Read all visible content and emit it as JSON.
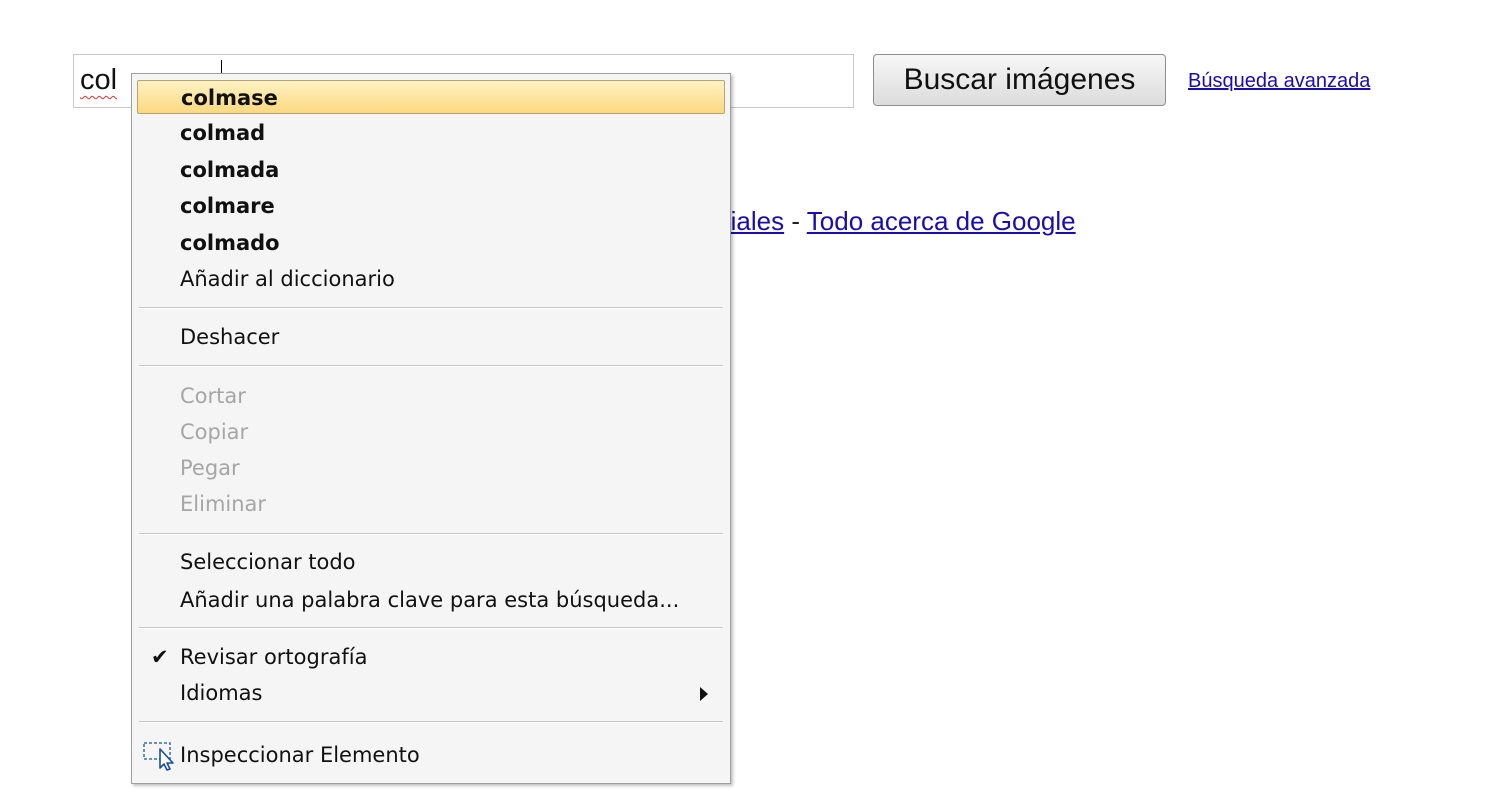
{
  "search": {
    "value": "colmastol",
    "visible_prefix": "col",
    "button_label": "Buscar imágenes",
    "advanced_link": "Búsqueda avanzada"
  },
  "footer": {
    "partial_link": "riales",
    "separator": " - ",
    "about_link": "Todo acerca de Google"
  },
  "context_menu": {
    "suggestions": [
      "colmase",
      "colmad",
      "colmada",
      "colmare",
      "colmado"
    ],
    "add_to_dictionary": "Añadir al diccionario",
    "undo": "Deshacer",
    "cut": "Cortar",
    "copy": "Copiar",
    "paste": "Pegar",
    "delete": "Eliminar",
    "select_all": "Seleccionar todo",
    "add_keyword": "Añadir una palabra clave para esta búsqueda...",
    "check_spelling": "Revisar ortografía",
    "check_spelling_checked": true,
    "languages": "Idiomas",
    "inspect_element": "Inspeccionar Elemento"
  },
  "colors": {
    "link": "#1a0dab",
    "highlight": "#fbd980",
    "disabled_text": "#a6a6a6"
  }
}
